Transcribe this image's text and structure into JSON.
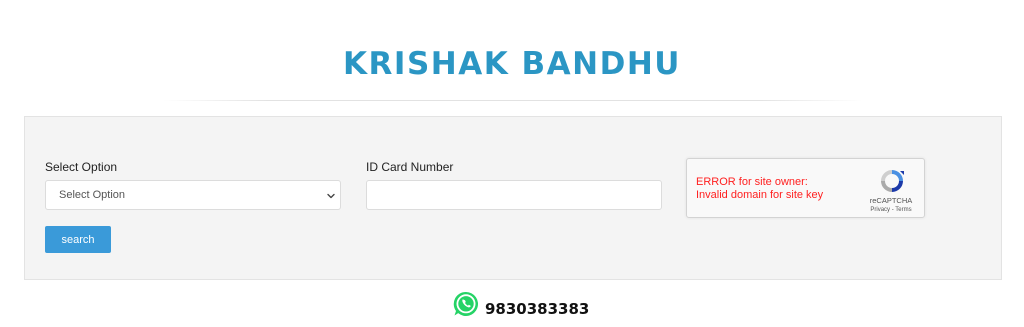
{
  "header": {
    "title": "KRISHAK BANDHU"
  },
  "form": {
    "select_label": "Select Option",
    "select_value": "Select Option",
    "id_label": "ID Card Number",
    "id_value": "",
    "search_label": "search"
  },
  "recaptcha": {
    "error_line1": "ERROR for site owner:",
    "error_line2": "Invalid domain for site key",
    "brand": "reCAPTCHA",
    "privacy_link": "Privacy",
    "separator": "-",
    "terms_link": "Terms"
  },
  "contact": {
    "icon": "whatsapp-icon",
    "phone": "9830383383"
  },
  "colors": {
    "title": "#2b96c4",
    "button": "#3a9ad9",
    "error": "#ff2020",
    "whatsapp": "#25d366"
  }
}
